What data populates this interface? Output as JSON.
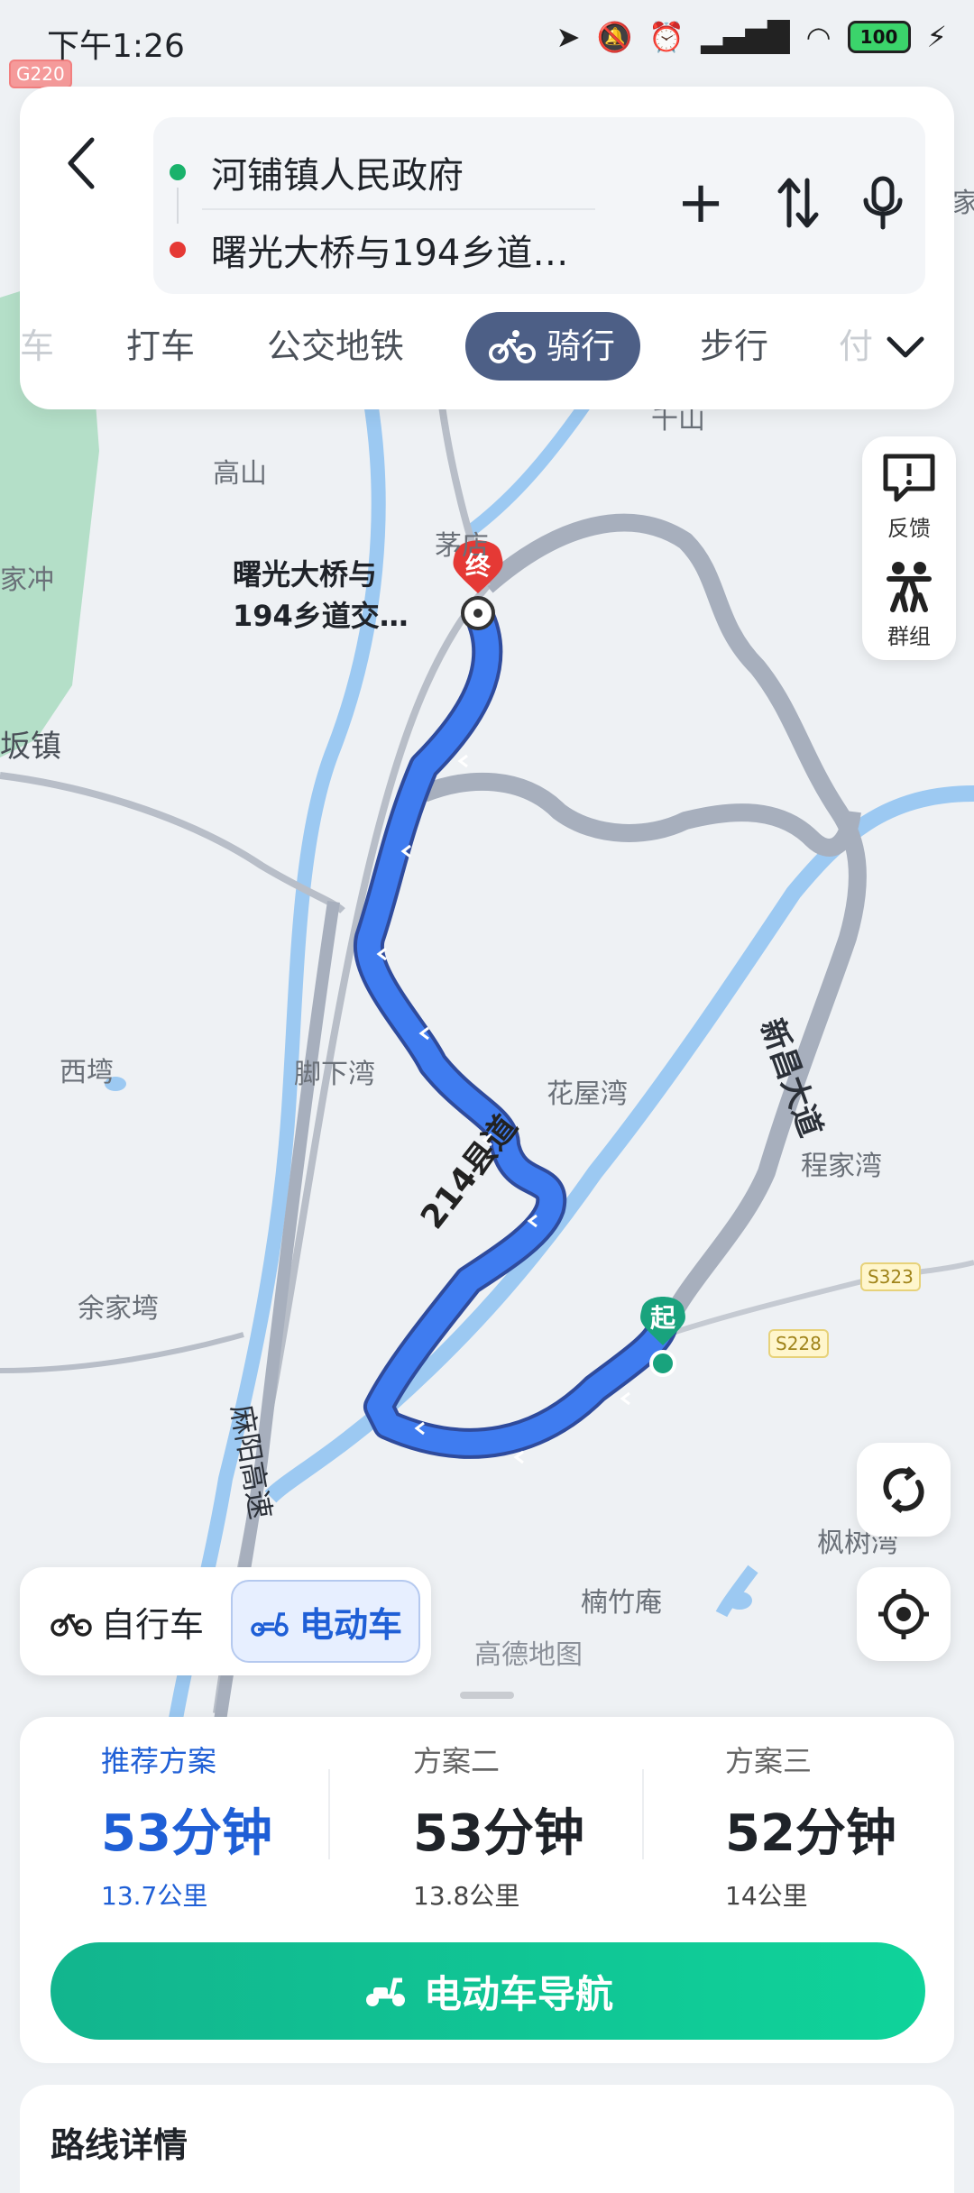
{
  "status_bar": {
    "time": "下午1:26",
    "battery": "100"
  },
  "search": {
    "origin": "河铺镇人民政府",
    "destination": "曙光大桥与194乡道…",
    "add_label": "+",
    "swap_label": "⇅"
  },
  "modes": [
    {
      "label": "车",
      "faded": true
    },
    {
      "label": "打车"
    },
    {
      "label": "公交地铁"
    },
    {
      "label": "骑行",
      "active": true
    },
    {
      "label": "步行"
    },
    {
      "label": "付",
      "faded": true
    }
  ],
  "side_buttons": {
    "feedback": "反馈",
    "group": "群组"
  },
  "map": {
    "labels": [
      "高山",
      "茅店",
      "家冲",
      "坂镇",
      "西塆",
      "脚下湾",
      "花屋湾",
      "程家湾",
      "余家塆",
      "楠竹庵",
      "枫树湾",
      "千山",
      "家"
    ],
    "road_labels": {
      "county_road": "214县道",
      "avenue": "新昌大道",
      "highway": "麻阳高速"
    },
    "badges": [
      "G220",
      "S323",
      "S228"
    ],
    "destination_name": [
      "曙光大桥与",
      "194乡道交…"
    ],
    "end_marker": "终",
    "start_marker": "起",
    "brand": "高德地图"
  },
  "vehicle": {
    "bike": "自行车",
    "ebike": "电动车",
    "active": "ebike"
  },
  "plans": [
    {
      "label": "推荐方案",
      "duration": "53分钟",
      "distance": "13.7公里",
      "active": true
    },
    {
      "label": "方案二",
      "duration": "53分钟",
      "distance": "13.8公里"
    },
    {
      "label": "方案三",
      "duration": "52分钟",
      "distance": "14公里"
    }
  ],
  "nav_button": "电动车导航",
  "route_details_title": "路线详情",
  "colors": {
    "route": "#3f7cf0",
    "accent": "#1f5fd6",
    "start": "#19a37d",
    "end": "#e53935",
    "nav": "#12c08f"
  }
}
